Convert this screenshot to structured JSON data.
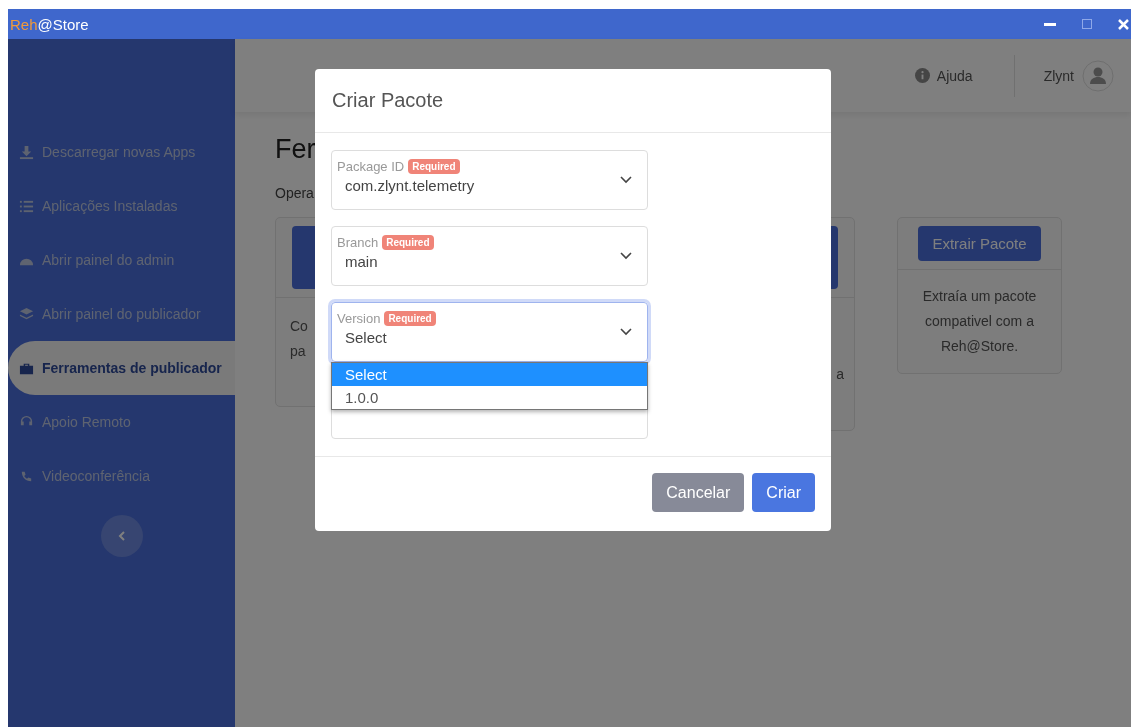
{
  "window": {
    "brand_accent": "Reh",
    "brand_rest": "@Store"
  },
  "sidebar": {
    "items": [
      {
        "label": "Descarregar novas Apps",
        "selected": false
      },
      {
        "label": "Aplicações Instaladas",
        "selected": false
      },
      {
        "label": "Abrir painel do admin",
        "selected": false
      },
      {
        "label": "Abrir painel do publicador",
        "selected": false
      },
      {
        "label": "Ferramentas de publicador",
        "selected": true
      },
      {
        "label": "Apoio Remoto",
        "selected": false
      },
      {
        "label": "Videoconferência",
        "selected": false
      }
    ]
  },
  "header": {
    "help": "Ajuda",
    "user": "Zlynt"
  },
  "page": {
    "title": "Fer",
    "subtitle": "Opera",
    "cards": [
      {
        "lines": [
          "Co",
          "pa"
        ]
      },
      {
        "lines": [
          "a"
        ]
      },
      {
        "button": "Extrair Pacote",
        "text": "Extraía um pacote compativel com a Reh@Store."
      }
    ]
  },
  "modal": {
    "title": "Criar Pacote",
    "fields": [
      {
        "kind": "select",
        "label": "Package ID",
        "badge": "Required",
        "value": "com.zlynt.telemetry",
        "focused": false
      },
      {
        "kind": "select",
        "label": "Branch",
        "badge": "Required",
        "value": "main",
        "focused": false
      },
      {
        "kind": "select",
        "label": "Version",
        "badge": "Required",
        "value": "Select",
        "focused": true,
        "options": [
          {
            "label": "Select",
            "selected": true
          },
          {
            "label": "1.0.0",
            "selected": false
          }
        ]
      },
      {
        "kind": "blank"
      }
    ],
    "buttons": [
      {
        "label": "Cancelar",
        "kind": "secondary"
      },
      {
        "label": "Criar",
        "kind": "primary"
      }
    ]
  }
}
